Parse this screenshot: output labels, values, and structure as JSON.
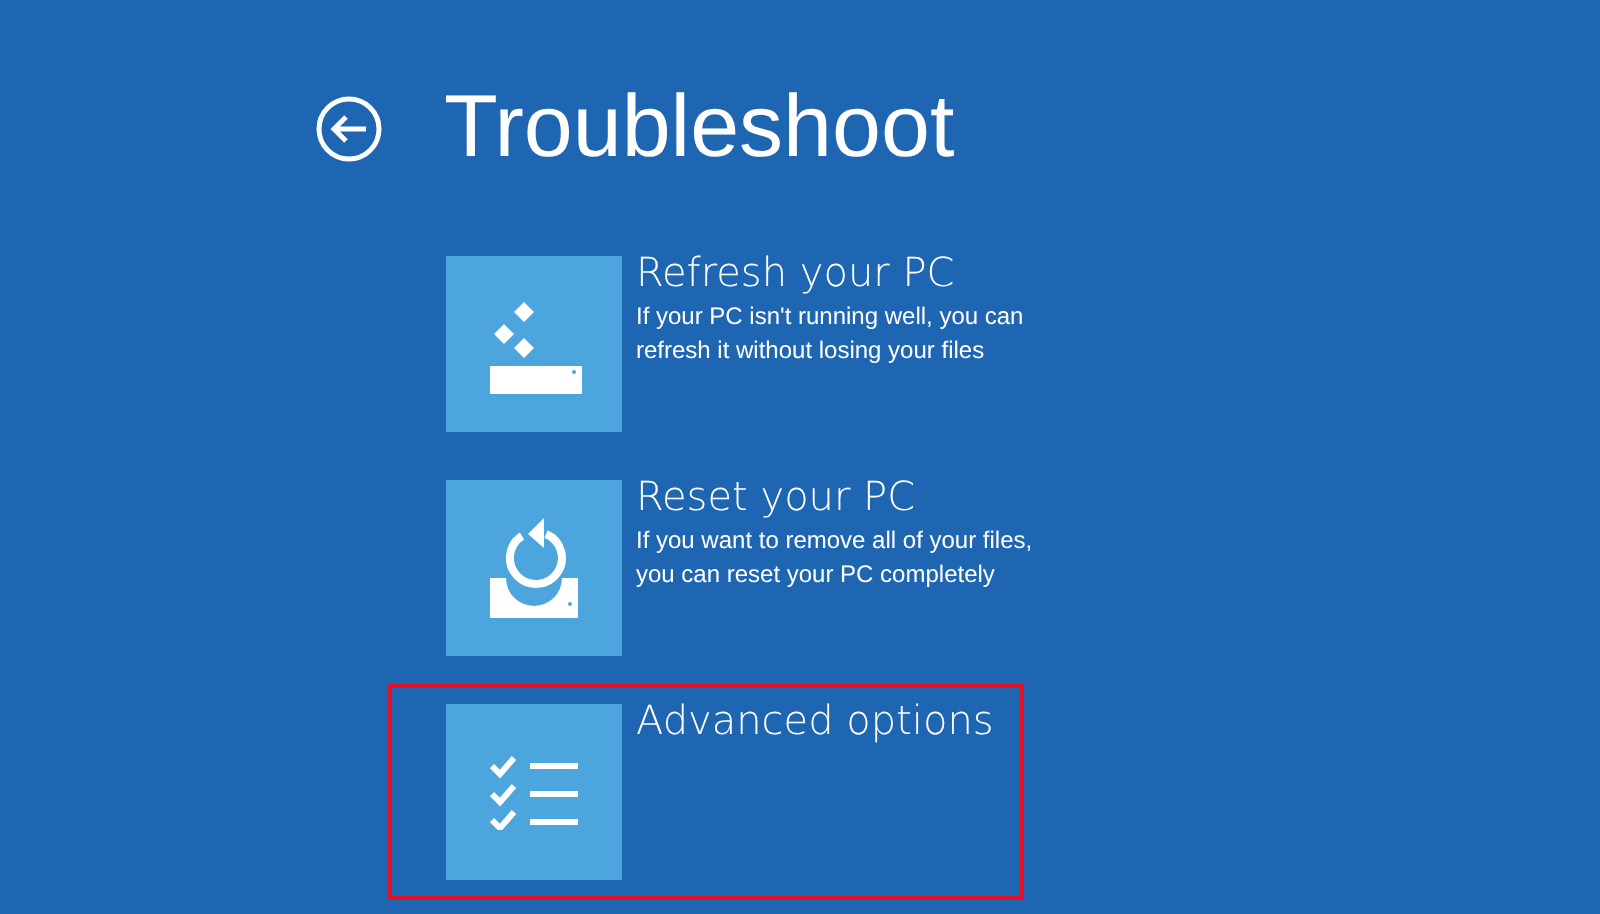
{
  "title": "Troubleshoot",
  "options": [
    {
      "kind": "refresh",
      "label": "Refresh your PC",
      "description": "If your PC isn't running well, you can refresh it without losing your files",
      "highlighted": false
    },
    {
      "kind": "reset",
      "label": "Reset your PC",
      "description": "If you want to remove all of your files, you can reset your PC completely",
      "highlighted": false
    },
    {
      "kind": "advanced",
      "label": "Advanced options",
      "highlighted": true
    }
  ]
}
